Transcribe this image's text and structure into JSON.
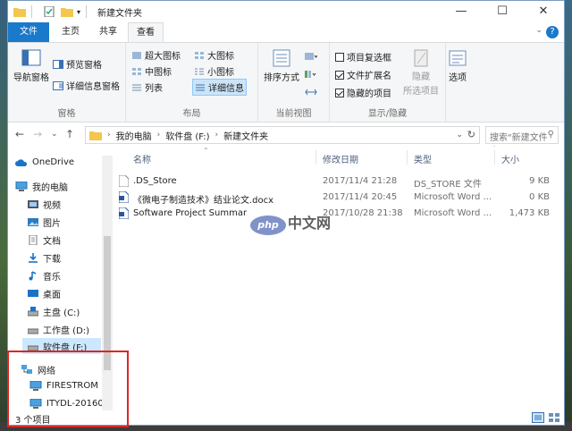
{
  "window": {
    "title": "新建文件夹",
    "minimize": "—",
    "maximize": "☐",
    "close": "✕"
  },
  "tabs": {
    "file": "文件",
    "home": "主页",
    "share": "共享",
    "view": "查看"
  },
  "ribbon": {
    "panes": {
      "nav_pane": "导航窗格",
      "preview_pane": "预览窗格",
      "details_pane": "详细信息窗格",
      "label": "窗格"
    },
    "layout": {
      "extra_large": "超大图标",
      "large": "大图标",
      "medium": "中图标",
      "small": "小图标",
      "list": "列表",
      "details": "详细信息",
      "label": "布局"
    },
    "current_view": {
      "sort": "排序方式",
      "label": "当前视图"
    },
    "show_hide": {
      "item_checkbox": "项目复选框",
      "extensions": "文件扩展名",
      "hidden_items": "隐藏的项目",
      "hide_selected_1": "隐藏",
      "hide_selected_2": "所选项目",
      "label": "显示/隐藏",
      "item_checkbox_on": false,
      "extensions_on": true,
      "hidden_items_on": true
    },
    "options": "选项"
  },
  "address": {
    "crumbs": [
      "我的电脑",
      "软件盘 (F:)",
      "新建文件夹"
    ],
    "search_placeholder": "搜索\"新建文件夹\""
  },
  "nav": {
    "items": [
      {
        "label": "OneDrive"
      },
      {
        "label": "我的电脑"
      },
      {
        "label": "视频"
      },
      {
        "label": "图片"
      },
      {
        "label": "文档"
      },
      {
        "label": "下载"
      },
      {
        "label": "音乐"
      },
      {
        "label": "桌面"
      },
      {
        "label": "主盘 (C:)"
      },
      {
        "label": "工作盘 (D:)"
      },
      {
        "label": "软件盘 (F:)"
      },
      {
        "label": "网络"
      },
      {
        "label": "FIRESTROM"
      },
      {
        "label": "ITYDL-20160"
      }
    ]
  },
  "columns": {
    "name": "名称",
    "date": "修改日期",
    "type": "类型",
    "size": "大小"
  },
  "files": [
    {
      "name": ".DS_Store",
      "date": "2017/11/4 21:28",
      "type": "DS_STORE 文件",
      "size": "9 KB"
    },
    {
      "name": "《微电子制造技术》结业论文.docx",
      "date": "2017/11/4 20:45",
      "type": "Microsoft Word ...",
      "size": "0 KB"
    },
    {
      "name": "Software Project Summar",
      "date": "2017/10/28 21:38",
      "type": "Microsoft Word ...",
      "size": "1,473 KB"
    }
  ],
  "status": {
    "count": "3 个项目"
  },
  "watermark": {
    "badge": "php",
    "text": "中文网"
  }
}
